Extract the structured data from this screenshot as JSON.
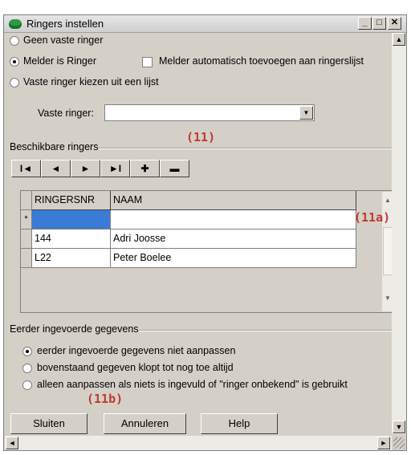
{
  "window": {
    "title": "Ringers instellen"
  },
  "options": {
    "geen_vaste": "Geen vaste ringer",
    "melder_is_ringer": "Melder is Ringer",
    "melder_auto": "Melder automatisch  toevoegen aan ringerslijst",
    "vaste_kiezen": "Vaste ringer kiezen uit een lijst"
  },
  "vaste_ringer": {
    "label": "Vaste ringer:",
    "value": ""
  },
  "annotations": {
    "a11": "(11)",
    "a11a": "(11a)",
    "a11b": "(11b)"
  },
  "group_beschikbaar": {
    "label": "Beschikbare ringers"
  },
  "navigator": {
    "first": "I◄",
    "prev": "◄",
    "next": "►",
    "last": "►I",
    "add": "✚",
    "delete": "▬"
  },
  "grid": {
    "columns": [
      "RINGERSNR",
      "NAAM"
    ],
    "new_row_marker": "*",
    "rows": [
      {
        "ringersnr": "144",
        "naam": "Adri Joosse"
      },
      {
        "ringersnr": "L22",
        "naam": "Peter Boelee"
      }
    ]
  },
  "group_eerder": {
    "label": "Eerder ingevoerde gegevens",
    "options": [
      "eerder ingevoerde gegevens niet aanpassen",
      "bovenstaand gegeven klopt tot nog toe altijd",
      "alleen aanpassen als niets is ingevuld of \"ringer onbekend\" is gebruikt"
    ]
  },
  "buttons": {
    "sluiten": "Sluiten",
    "annuleren": "Annuleren",
    "help": "Help"
  }
}
